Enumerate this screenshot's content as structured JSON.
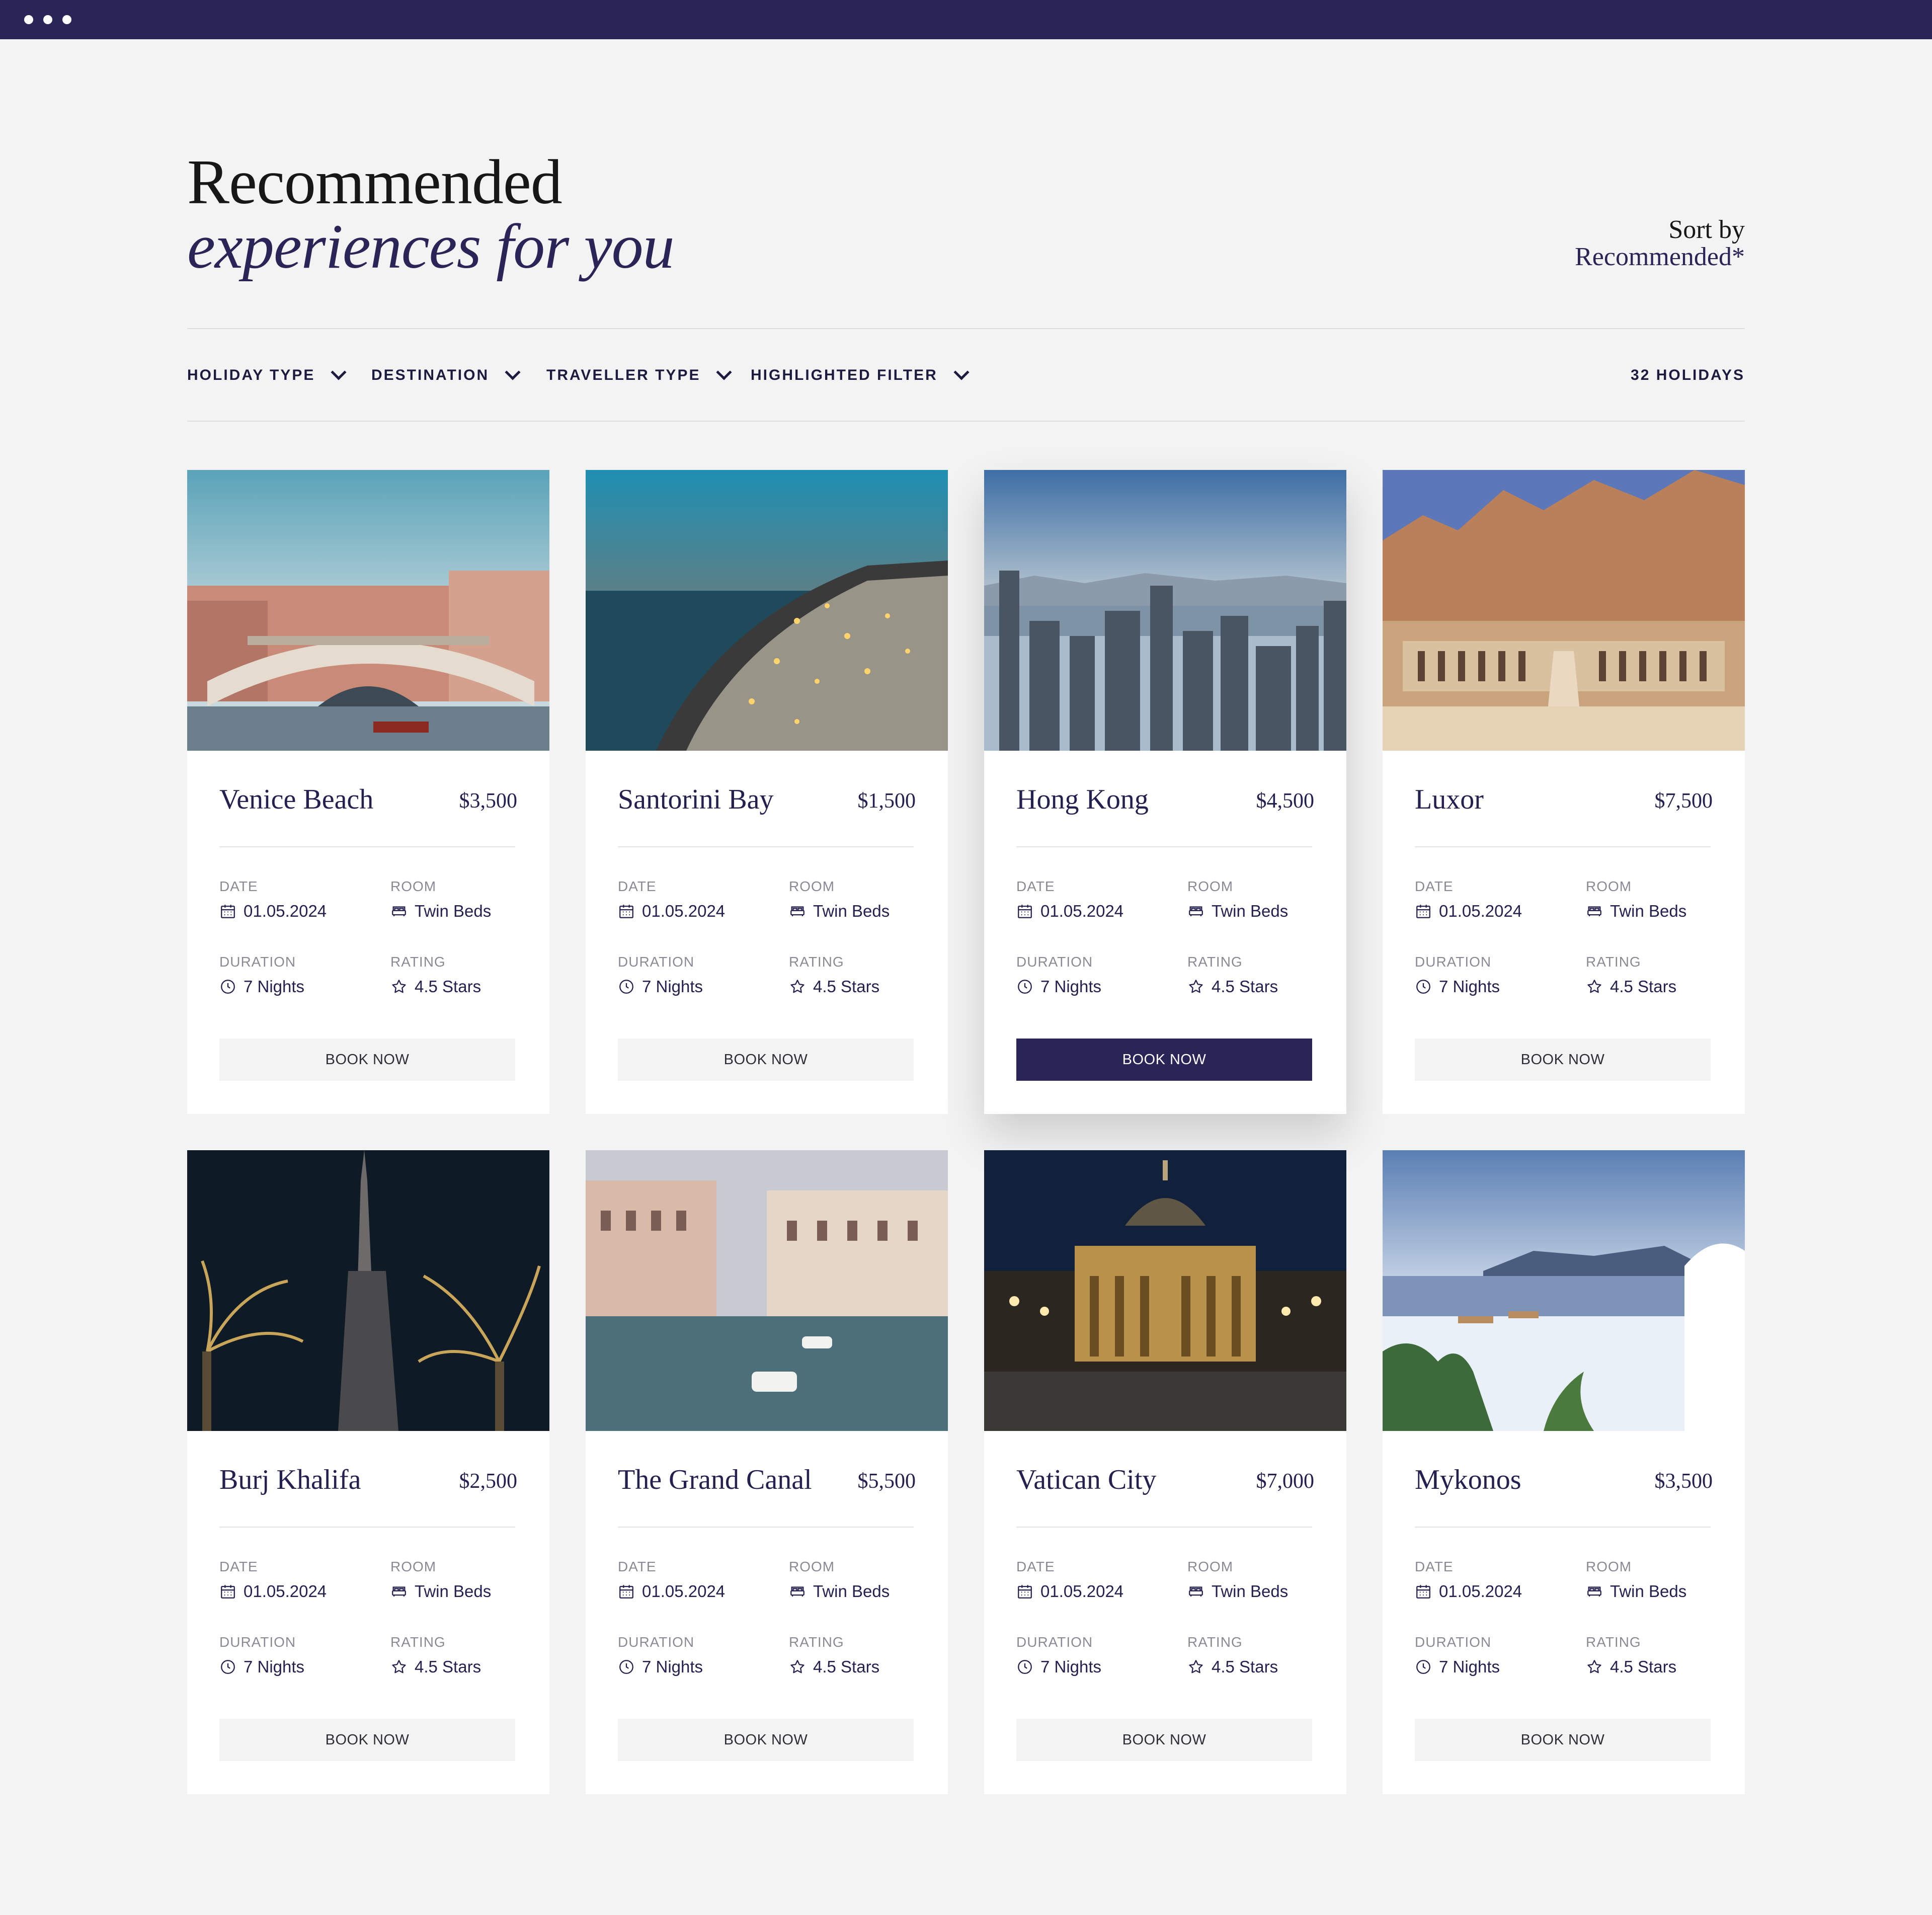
{
  "heading": {
    "line1": "Recommended",
    "line2": "experiences for you"
  },
  "sort": {
    "label": "Sort by",
    "value": "Recommended*"
  },
  "filters": [
    {
      "label": "HOLIDAY TYPE"
    },
    {
      "label": "DESTINATION"
    },
    {
      "label": "TRAVELLER TYPE"
    },
    {
      "label": "HIGHLIGHTED FILTER"
    }
  ],
  "result_count": "32 HOLIDAYS",
  "labels": {
    "date": "DATE",
    "room": "ROOM",
    "duration": "DURATION",
    "rating": "RATING",
    "book": "BOOK NOW"
  },
  "colors": {
    "brand": "#2b2456",
    "background": "#f3f3f4",
    "button_light": "#f4f3f4"
  },
  "icons": {
    "date": "calendar-icon",
    "room": "bed-icon",
    "duration": "clock-icon",
    "rating": "star-icon",
    "filter": "chevron-down-icon"
  },
  "cards": [
    {
      "title": "Venice Beach",
      "price": "$3,500",
      "date": "01.05.2024",
      "room": "Twin Beds",
      "duration": "7 Nights",
      "rating": "4.5 Stars",
      "highlighted": false
    },
    {
      "title": "Santorini Bay",
      "price": "$1,500",
      "date": "01.05.2024",
      "room": "Twin Beds",
      "duration": "7 Nights",
      "rating": "4.5 Stars",
      "highlighted": false
    },
    {
      "title": "Hong Kong",
      "price": "$4,500",
      "date": "01.05.2024",
      "room": "Twin Beds",
      "duration": "7 Nights",
      "rating": "4.5 Stars",
      "highlighted": true
    },
    {
      "title": "Luxor",
      "price": "$7,500",
      "date": "01.05.2024",
      "room": "Twin Beds",
      "duration": "7 Nights",
      "rating": "4.5 Stars",
      "highlighted": false
    },
    {
      "title": "Burj Khalifa",
      "price": "$2,500",
      "date": "01.05.2024",
      "room": "Twin Beds",
      "duration": "7 Nights",
      "rating": "4.5 Stars",
      "highlighted": false
    },
    {
      "title": "The Grand Canal",
      "price": "$5,500",
      "date": "01.05.2024",
      "room": "Twin Beds",
      "duration": "7 Nights",
      "rating": "4.5 Stars",
      "highlighted": false
    },
    {
      "title": "Vatican City",
      "price": "$7,000",
      "date": "01.05.2024",
      "room": "Twin Beds",
      "duration": "7 Nights",
      "rating": "4.5 Stars",
      "highlighted": false
    },
    {
      "title": "Mykonos",
      "price": "$3,500",
      "date": "01.05.2024",
      "room": "Twin Beds",
      "duration": "7 Nights",
      "rating": "4.5 Stars",
      "highlighted": false
    }
  ]
}
